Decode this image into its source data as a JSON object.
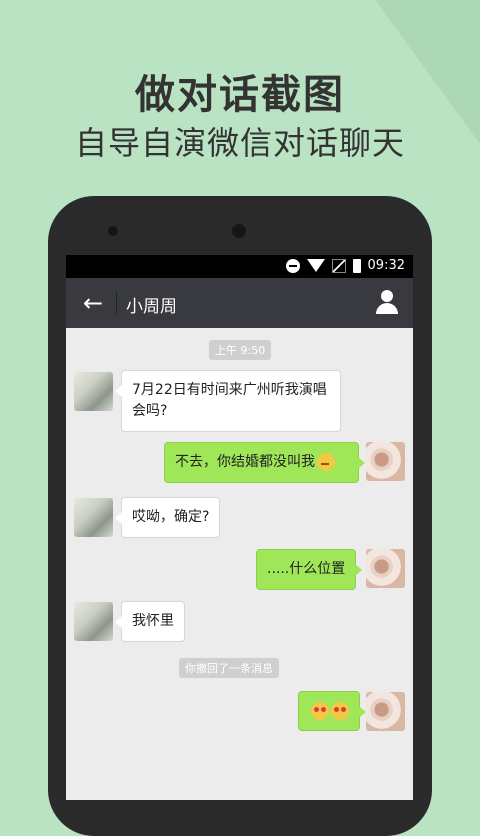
{
  "promo": {
    "headline": "做对话截图",
    "subheadline": "自导自演微信对话聊天"
  },
  "statusbar": {
    "time": "09:32",
    "icons": [
      "do-not-disturb-icon",
      "wifi-icon",
      "no-signal-icon",
      "battery-icon"
    ]
  },
  "appbar": {
    "title": "小周周"
  },
  "chat": {
    "time_badge": "上午 9:50",
    "messages": [
      {
        "side": "left",
        "text": "7月22日有时间来广州听我演唱会吗?"
      },
      {
        "side": "right",
        "text": "不去，你结婚都没叫我",
        "emoji": "thinking-emoji"
      },
      {
        "side": "left",
        "text": "哎呦，确定?"
      },
      {
        "side": "right",
        "text": ".....什么位置"
      },
      {
        "side": "left",
        "text": "我怀里"
      },
      {
        "side": "right",
        "text": "",
        "emoji": "heart-eyes-emoji x2"
      }
    ],
    "recall_notice": "你撤回了一条消息"
  },
  "colors": {
    "background": "#b9e3c3",
    "appbar": "#393a3f",
    "bubble_self": "#9fe658",
    "bubble_other": "#ffffff"
  }
}
